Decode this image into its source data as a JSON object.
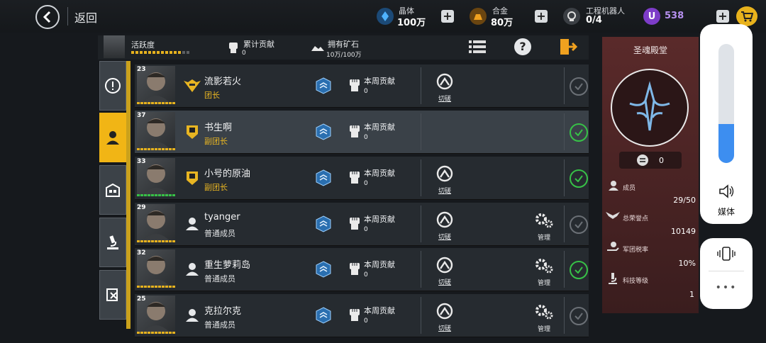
{
  "topbar": {
    "back_label": "返回",
    "crystal": {
      "label": "晶体",
      "value": "100万",
      "icon": "crystal-icon",
      "color": "#2f8fe0"
    },
    "alloy": {
      "label": "合金",
      "value": "80万",
      "icon": "alloy-icon",
      "color": "#e89a1e"
    },
    "robot": {
      "label": "工程机器人",
      "value": "0/4",
      "icon": "robot-icon"
    },
    "premium": {
      "value": "538",
      "icon": "u-coin-icon",
      "color": "#7d3cc8"
    }
  },
  "infobar": {
    "activity_label": "活跃度",
    "contribution_label": "累计贡献",
    "contribution_value": "0",
    "ore_label": "拥有矿石",
    "ore_value": "10万/100万"
  },
  "members": [
    {
      "level": "23",
      "name": "流影若火",
      "role": "团长",
      "role_style": "gold",
      "rank_icon": "wings-rank-icon",
      "week_label": "本周贡献",
      "week_value": "0",
      "switch_label": "切磋",
      "manage_label": "",
      "online": false,
      "hp": "gold"
    },
    {
      "level": "37",
      "name": "书生啊",
      "role": "副团长",
      "role_style": "gold",
      "rank_icon": "shield-fist-rank-icon",
      "week_label": "本周贡献",
      "week_value": "0",
      "switch_label": "",
      "manage_label": "",
      "online": true,
      "hp": "gold"
    },
    {
      "level": "33",
      "name": "小号的原油",
      "role": "副团长",
      "role_style": "gold",
      "rank_icon": "shield-fist-rank-icon",
      "week_label": "本周贡献",
      "week_value": "0",
      "switch_label": "切磋",
      "manage_label": "",
      "online": true,
      "hp": "green"
    },
    {
      "level": "29",
      "name": "tyanger",
      "role": "普通成员",
      "role_style": "white",
      "rank_icon": "person-icon",
      "week_label": "本周贡献",
      "week_value": "0",
      "switch_label": "切磋",
      "manage_label": "管理",
      "online": false,
      "hp": "gold"
    },
    {
      "level": "32",
      "name": "重生萝莉岛",
      "role": "普通成员",
      "role_style": "white",
      "rank_icon": "person-icon",
      "week_label": "本周贡献",
      "week_value": "0",
      "switch_label": "切磋",
      "manage_label": "管理",
      "online": true,
      "hp": "gold"
    },
    {
      "level": "25",
      "name": "克拉尔克",
      "role": "普通成员",
      "role_style": "white",
      "rank_icon": "person-icon",
      "week_label": "本周贡献",
      "week_value": "0",
      "switch_label": "切磋",
      "manage_label": "管理",
      "online": false,
      "hp": "gold"
    }
  ],
  "hall": {
    "title": "圣魂殿堂",
    "emblem_value": "0",
    "members_label": "成员",
    "members_value": "29/50",
    "honor_label": "总荣誉点",
    "honor_value": "10149",
    "tax_label": "军团税率",
    "tax_value": "10%",
    "tech_label": "科技等级",
    "tech_value": "1"
  },
  "volume": {
    "label": "媒体",
    "level": 0.33
  }
}
